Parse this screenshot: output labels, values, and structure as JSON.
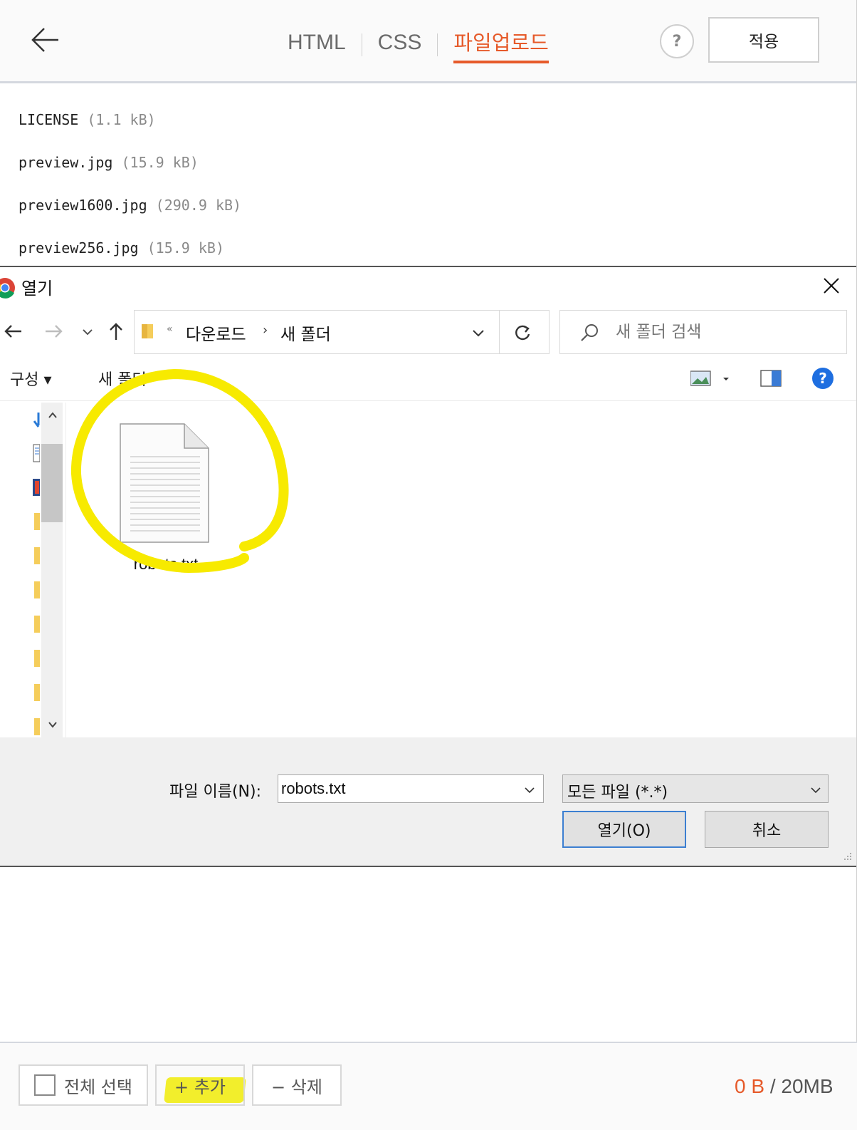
{
  "header": {
    "tabs": [
      {
        "label": "HTML",
        "active": false
      },
      {
        "label": "CSS",
        "active": false
      },
      {
        "label": "파일업로드",
        "active": true
      }
    ],
    "help_label": "?",
    "apply_label": "적용",
    "accent": "#e65a2a"
  },
  "files": [
    {
      "name": "LICENSE",
      "size": "(1.1 kB)"
    },
    {
      "name": "preview.jpg",
      "size": "(15.9 kB)"
    },
    {
      "name": "preview1600.jpg",
      "size": "(290.9 kB)"
    },
    {
      "name": "preview256.jpg",
      "size": "(15.9 kB)"
    }
  ],
  "dialog": {
    "title": "열기",
    "breadcrumb": [
      "다운로드",
      "새 폴더"
    ],
    "search_placeholder": "새 폴더 검색",
    "toolbar": {
      "organize": "구성 ▾",
      "new_folder": "새 폴더"
    },
    "items": [
      {
        "name": "robots.txt",
        "icon": "text-file-icon"
      }
    ],
    "filename_label": "파일 이름(N):",
    "filename_value": "robots.txt",
    "filetype_value": "모든 파일 (*.*)",
    "open_label": "열기(O)",
    "cancel_label": "취소",
    "highlight_color": "#f2ee2c"
  },
  "bottom": {
    "select_all": "전체 선택",
    "add": "+ 추가",
    "delete": "− 삭제",
    "storage_used": "0 B",
    "storage_total": "/ 20MB"
  }
}
